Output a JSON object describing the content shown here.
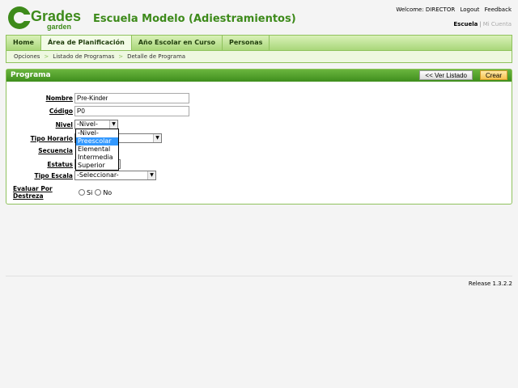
{
  "header": {
    "logo_main": "Grades",
    "logo_sub": "garden",
    "school_title": "Escuela Modelo (Adiestramientos)",
    "welcome": "Welcome: DIRECTOR",
    "logout": "Logout",
    "feedback": "Feedback",
    "escuela": "Escuela",
    "sep": "|",
    "mi_cuenta": "Mi Cuenta"
  },
  "nav": {
    "tabs": [
      {
        "label": "Home"
      },
      {
        "label": "Área de Planificación"
      },
      {
        "label": "Año Escolar en Curso"
      },
      {
        "label": "Personas"
      }
    ]
  },
  "breadcrumb": {
    "items": [
      "Opciones",
      "Listado de Programas",
      "Detalle de Programa"
    ],
    "sep": ">"
  },
  "panel": {
    "title": "Programa",
    "list_button": "<< Ver Listado",
    "create_button": "Crear"
  },
  "form": {
    "nombre_label": "Nombre",
    "nombre_value": "Pre-Kinder",
    "codigo_label": "Código",
    "codigo_value": "P0",
    "nivel_label": "Nivel",
    "nivel_selected": "-Nivel-",
    "nivel_options": [
      "-Nivel-",
      "Preescolar",
      "Elemental",
      "Intermedia",
      "Superior"
    ],
    "tipo_horario_label": "Tipo Horario",
    "secuencia_label": "Secuencia",
    "estatus_label": "Estatus",
    "tipo_escala_label": "Tipo Escala",
    "tipo_escala_selected": "-Seleccionar-",
    "destreza_label": "Evaluar Por Destreza",
    "si": "Si",
    "no": "No"
  },
  "footer": {
    "release": "Release 1.3.2.2"
  },
  "colors": {
    "brand_green": "#3d8a1a",
    "highlight_blue": "#3399ff"
  }
}
